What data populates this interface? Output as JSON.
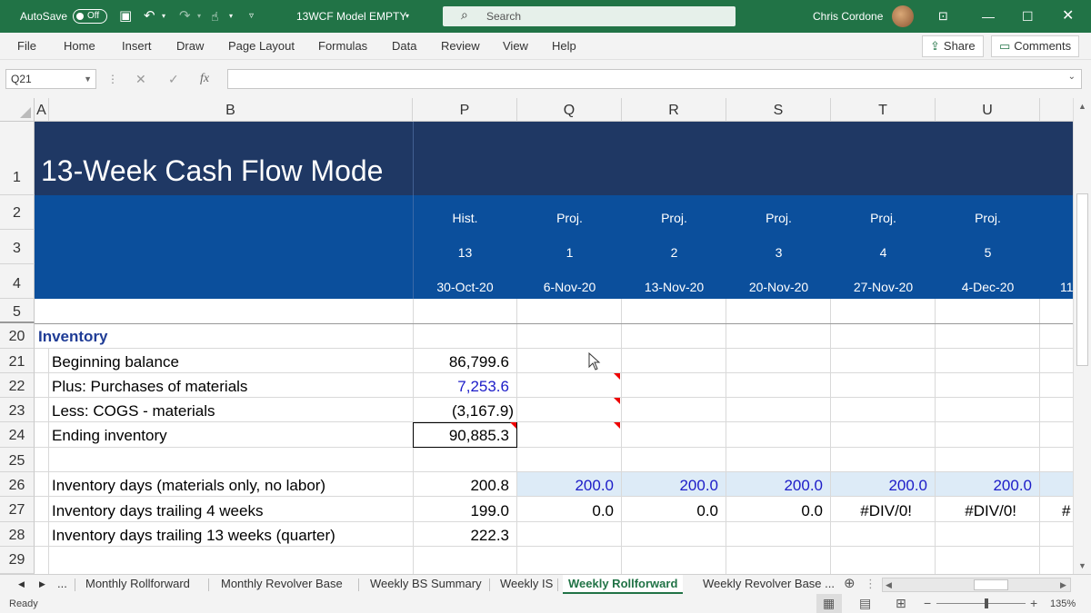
{
  "titlebar": {
    "autosave": "AutoSave",
    "toggle": "Off",
    "filename": "13WCF Model EMPTY",
    "search_placeholder": "Search",
    "user": "Chris Cordone"
  },
  "menu": [
    "File",
    "Home",
    "Insert",
    "Draw",
    "Page Layout",
    "Formulas",
    "Data",
    "Review",
    "View",
    "Help"
  ],
  "share": "Share",
  "comments": "Comments",
  "namebox": "Q21",
  "fx_label": "fx",
  "columns": [
    "A",
    "B",
    "P",
    "Q",
    "R",
    "S",
    "T",
    "U"
  ],
  "rows": [
    "1",
    "2",
    "3",
    "4",
    "5",
    "20",
    "21",
    "22",
    "23",
    "24",
    "25",
    "26",
    "27",
    "28",
    "29"
  ],
  "sheet_title": "13-Week Cash Flow Mode",
  "period_types": [
    "Hist.",
    "Proj.",
    "Proj.",
    "Proj.",
    "Proj.",
    "Proj."
  ],
  "week_numbers": [
    "13",
    "1",
    "2",
    "3",
    "4",
    "5"
  ],
  "dates": [
    "30-Oct-20",
    "6-Nov-20",
    "13-Nov-20",
    "20-Nov-20",
    "27-Nov-20",
    "4-Dec-20"
  ],
  "clipped_next": {
    "week_date": "11",
    "div": "#"
  },
  "section": "Inventory",
  "line_items": {
    "beginning": {
      "label": "Beginning balance",
      "p": "86,799.6"
    },
    "purchases": {
      "label": "Plus: Purchases of materials",
      "p": "7,253.6"
    },
    "cogs": {
      "label": "Less: COGS - materials",
      "p": "(3,167.9)"
    },
    "ending": {
      "label": "Ending inventory",
      "p": "90,885.3"
    },
    "inv_days": {
      "label": "Inventory days (materials only, no labor)",
      "values": [
        "200.8",
        "200.0",
        "200.0",
        "200.0",
        "200.0",
        "200.0"
      ]
    },
    "trailing4": {
      "label": "Inventory days trailing 4 weeks",
      "values": [
        "199.0",
        "0.0",
        "0.0",
        "0.0",
        "#DIV/0!",
        "#DIV/0!"
      ]
    },
    "trailing13": {
      "label": "Inventory days trailing 13 weeks (quarter)",
      "p": "222.3"
    }
  },
  "sheet_tabs": [
    "Monthly Rollforward",
    "Monthly Revolver Base",
    "Weekly BS Summary",
    "Weekly IS",
    "Weekly Rollforward",
    "Weekly Revolver Base ..."
  ],
  "active_tab": "Weekly Rollforward",
  "status": {
    "ready": "Ready",
    "zoom": "135%"
  },
  "colors": {
    "excel_green": "#217346",
    "title_band": "#1f3864",
    "header_band": "#0b4f9c",
    "input_blue": "#1c1cc8"
  }
}
